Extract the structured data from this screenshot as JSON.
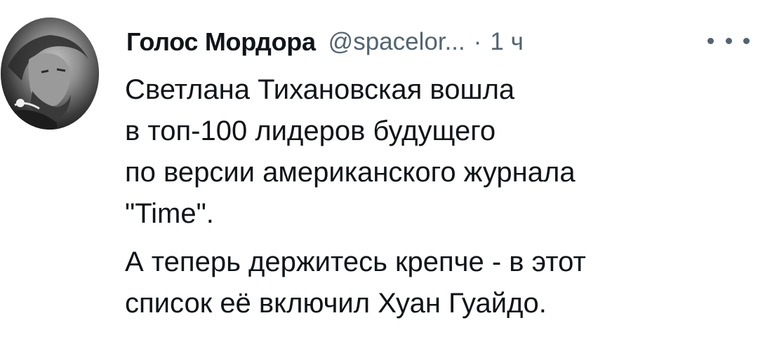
{
  "tweet": {
    "author_name": "Голос Мордора",
    "handle": "@spacelor...",
    "separator": "·",
    "time": "1 ч",
    "avatar_icon": "user-avatar",
    "more_icon": "more-options-icon",
    "paragraphs": [
      {
        "lines": [
          "Светлана Тихановская вошла",
          "в топ-100 лидеров будущего",
          "по версии американского журнала",
          "\"Time\"."
        ]
      },
      {
        "lines": [
          "А теперь держитесь крепче - в этот",
          "список её включил Хуан Гуайдо."
        ]
      }
    ]
  },
  "colors": {
    "text": "#0f1419",
    "secondary": "#536471",
    "background": "#ffffff"
  }
}
